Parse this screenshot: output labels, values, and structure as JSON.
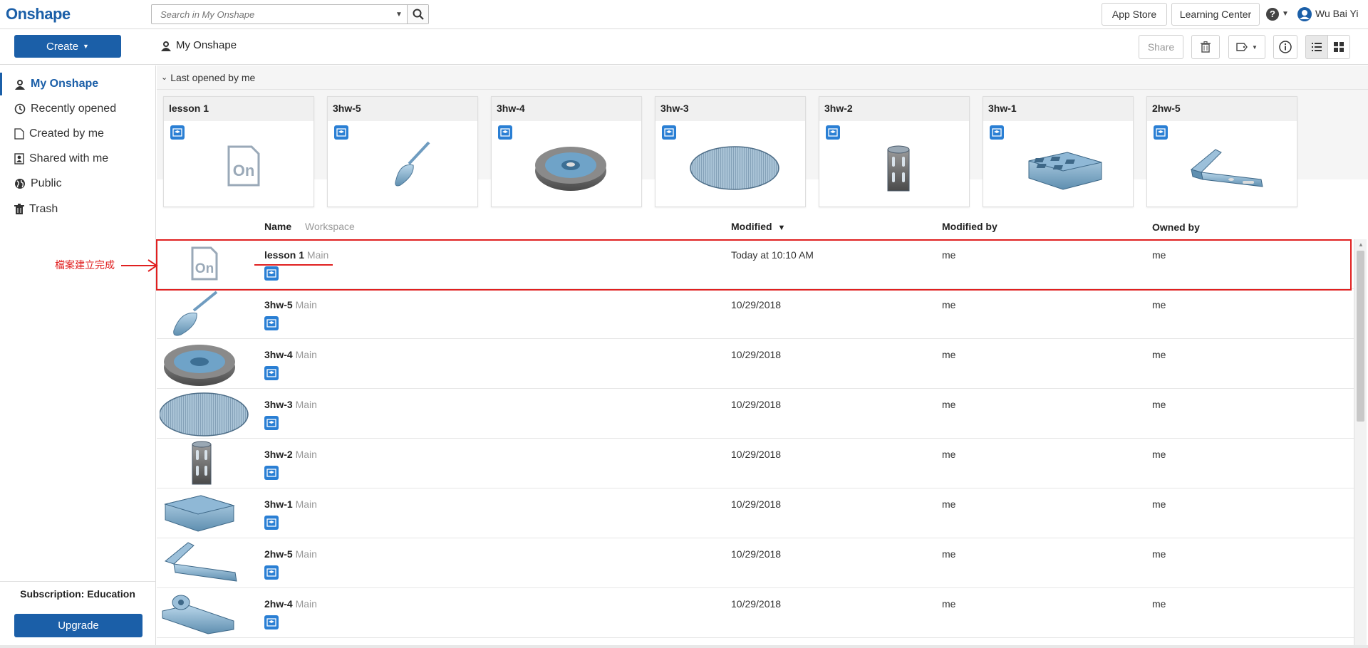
{
  "app": {
    "logo": "Onshape"
  },
  "search": {
    "placeholder": "Search in My Onshape"
  },
  "header": {
    "app_store": "App Store",
    "learning_center": "Learning Center",
    "help_icon": "?",
    "user_name": "Wu Bai Yi"
  },
  "toolbar": {
    "create_label": "Create",
    "breadcrumb": "My Onshape",
    "share_label": "Share"
  },
  "sidebar": {
    "items": [
      {
        "label": "My Onshape",
        "icon": "person-icon",
        "active": true
      },
      {
        "label": "Recently opened",
        "icon": "clock-icon"
      },
      {
        "label": "Created by me",
        "icon": "document-icon"
      },
      {
        "label": "Shared with me",
        "icon": "shared-icon"
      },
      {
        "label": "Public",
        "icon": "globe-icon"
      },
      {
        "label": "Trash",
        "icon": "trash-icon"
      }
    ],
    "subscription": "Subscription: Education",
    "upgrade": "Upgrade"
  },
  "recent": {
    "header": "Last opened by me",
    "cards": [
      {
        "title": "lesson 1",
        "thumb": "onshape-doc"
      },
      {
        "title": "3hw-5",
        "thumb": "tool"
      },
      {
        "title": "3hw-4",
        "thumb": "bearing"
      },
      {
        "title": "3hw-3",
        "thumb": "disc"
      },
      {
        "title": "3hw-2",
        "thumb": "cylinder"
      },
      {
        "title": "3hw-1",
        "thumb": "block"
      },
      {
        "title": "2hw-5",
        "thumb": "bracket"
      }
    ]
  },
  "table": {
    "columns": {
      "name": "Name",
      "workspace": "Workspace",
      "modified": "Modified",
      "modified_by": "Modified by",
      "owned_by": "Owned by"
    },
    "sort_indicator": "▼",
    "rows": [
      {
        "name": "lesson 1",
        "workspace": "Main",
        "modified": "Today at 10:10 AM",
        "modified_by": "me",
        "owned_by": "me",
        "thumb": "onshape-doc"
      },
      {
        "name": "3hw-5",
        "workspace": "Main",
        "modified": "10/29/2018",
        "modified_by": "me",
        "owned_by": "me",
        "thumb": "tool"
      },
      {
        "name": "3hw-4",
        "workspace": "Main",
        "modified": "10/29/2018",
        "modified_by": "me",
        "owned_by": "me",
        "thumb": "bearing"
      },
      {
        "name": "3hw-3",
        "workspace": "Main",
        "modified": "10/29/2018",
        "modified_by": "me",
        "owned_by": "me",
        "thumb": "disc"
      },
      {
        "name": "3hw-2",
        "workspace": "Main",
        "modified": "10/29/2018",
        "modified_by": "me",
        "owned_by": "me",
        "thumb": "cylinder"
      },
      {
        "name": "3hw-1",
        "workspace": "Main",
        "modified": "10/29/2018",
        "modified_by": "me",
        "owned_by": "me",
        "thumb": "block"
      },
      {
        "name": "2hw-5",
        "workspace": "Main",
        "modified": "10/29/2018",
        "modified_by": "me",
        "owned_by": "me",
        "thumb": "bracket"
      },
      {
        "name": "2hw-4",
        "workspace": "Main",
        "modified": "10/29/2018",
        "modified_by": "me",
        "owned_by": "me",
        "thumb": "hinge"
      }
    ]
  },
  "annotation": {
    "text": "檔案建立完成",
    "color": "#e02020"
  },
  "colors": {
    "brand": "#1b5fa8",
    "badge": "#2a7fd4",
    "annotation": "#e02020"
  }
}
